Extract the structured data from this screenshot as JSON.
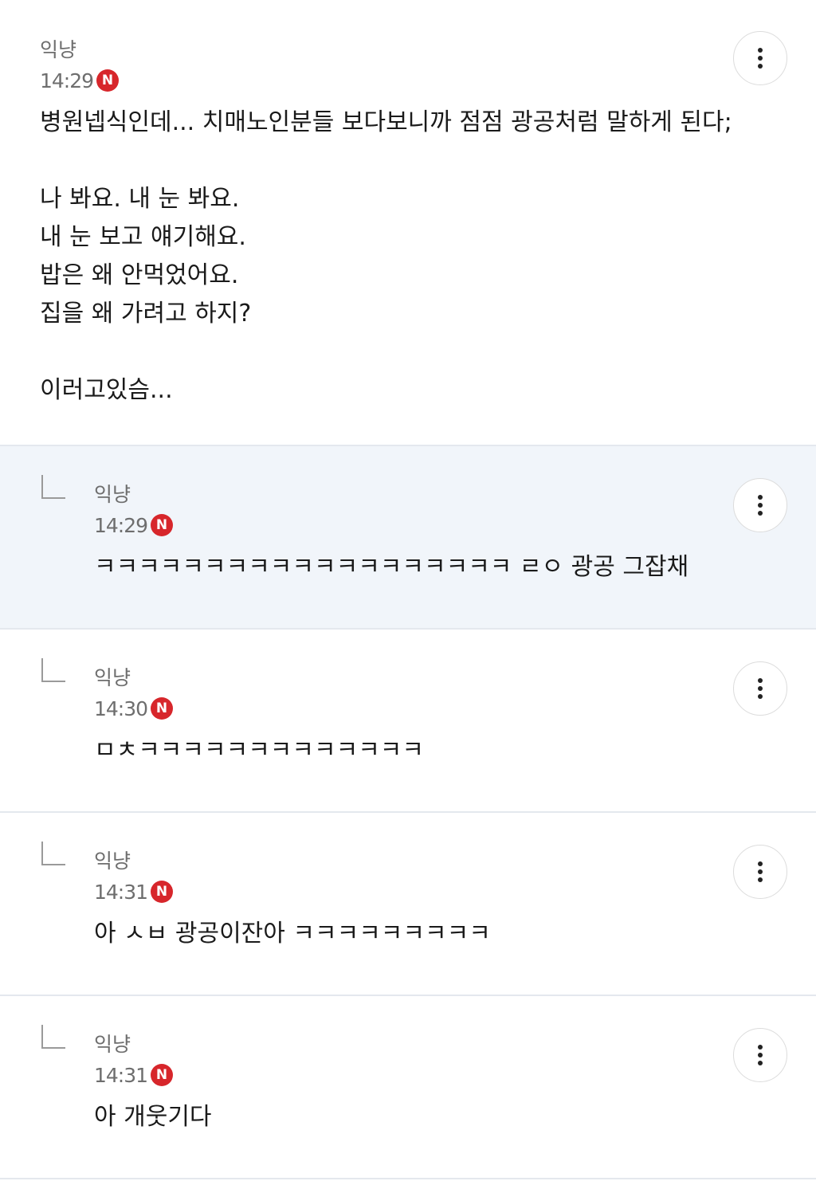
{
  "post": {
    "author": "익냥",
    "time": "14:29",
    "new_badge": "N",
    "lines": [
      "병원넵식인데... 치매노인분들 보다보니까 점점 광공처럼 말하게 된다;",
      "",
      "나 봐요. 내 눈 봐요.",
      "내 눈 보고 얘기해요.",
      "밥은 왜 안먹었어요.",
      "집을 왜 가려고 하지?",
      "",
      "이러고있슴..."
    ]
  },
  "comments": [
    {
      "author": "익냥",
      "time": "14:29",
      "new_badge": "N",
      "text": "ㅋㅋㅋㅋㅋㅋㅋㅋㅋㅋㅋㅋㅋㅋㅋㅋㅋㅋㅋ ㄹㅇ 광공 그잡채"
    },
    {
      "author": "익냥",
      "time": "14:30",
      "new_badge": "N",
      "text": "ㅁㅊㅋㅋㅋㅋㅋㅋㅋㅋㅋㅋㅋㅋㅋ"
    },
    {
      "author": "익냥",
      "time": "14:31",
      "new_badge": "N",
      "text": "아 ㅅㅂ 광공이잔아 ㅋㅋㅋㅋㅋㅋㅋㅋㅋ"
    },
    {
      "author": "익냥",
      "time": "14:31",
      "new_badge": "N",
      "text": "아 개웃기다"
    }
  ],
  "icons": {
    "more": "more-vertical-icon",
    "reply": "reply-corner-icon"
  },
  "colors": {
    "new_badge": "#d7262b",
    "highlight_background": "#f1f5fa",
    "meta_text": "#6e6e6e"
  }
}
